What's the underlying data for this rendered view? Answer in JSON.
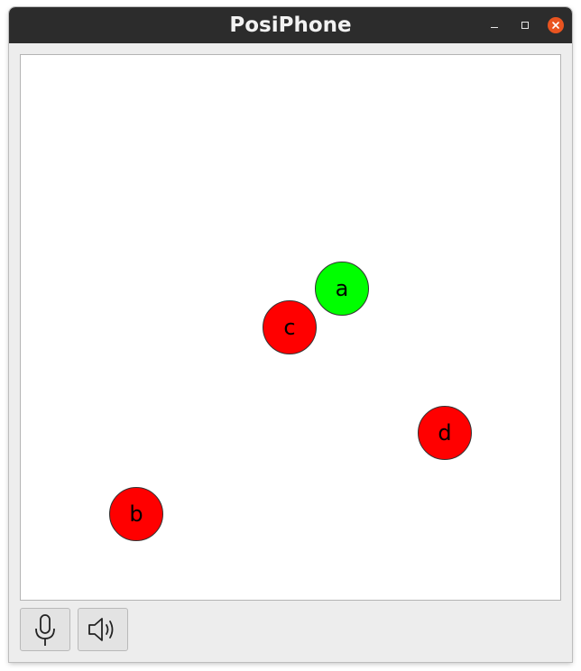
{
  "window": {
    "title": "PosiPhone",
    "controls": {
      "minimize_icon": "minimize-icon",
      "maximize_icon": "maximize-icon",
      "close_icon": "close-icon",
      "close_color": "#e95420"
    }
  },
  "canvas": {
    "nodes": [
      {
        "label": "a",
        "color": "#00ff00"
      },
      {
        "label": "c",
        "color": "#ff0000"
      },
      {
        "label": "d",
        "color": "#ff0000"
      },
      {
        "label": "b",
        "color": "#ff0000"
      }
    ]
  },
  "toolbar": {
    "buttons": [
      {
        "icon": "microphone-icon"
      },
      {
        "icon": "speaker-icon"
      }
    ]
  }
}
